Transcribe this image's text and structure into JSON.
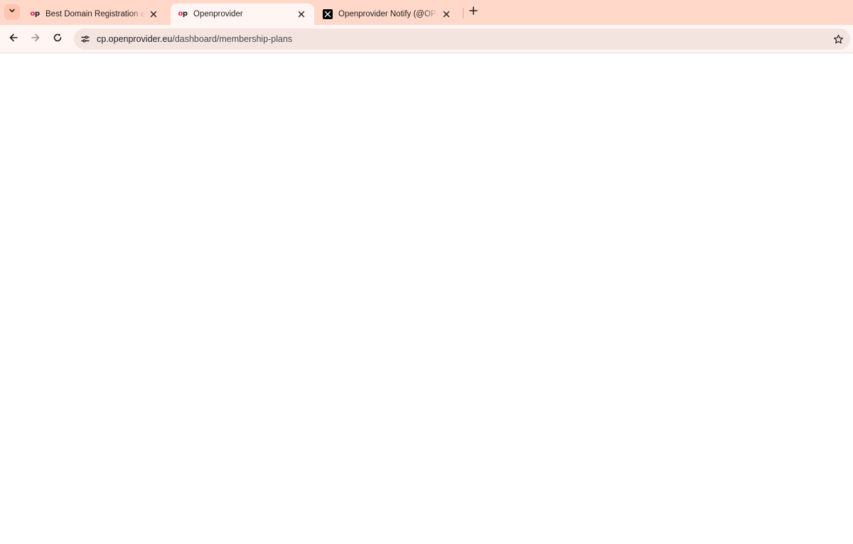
{
  "browser": {
    "tabs": [
      {
        "title": "Best Domain Registration and R",
        "favicon": "openprovider-logo",
        "active": false
      },
      {
        "title": "Openprovider",
        "favicon": "openprovider-logo",
        "active": true
      },
      {
        "title": "Openprovider Notify (@OPNoti",
        "favicon": "x-logo",
        "active": false
      }
    ],
    "favicon_text": "op",
    "address_bar": {
      "domain": "cp.openprovider.eu",
      "path": "/dashboard/membership-plans"
    },
    "icons": {
      "tab_search": "chevron-down-icon",
      "close": "close-icon",
      "new_tab": "plus-icon",
      "back": "arrow-left-icon",
      "forward": "arrow-right-icon",
      "reload": "reload-icon",
      "site_info": "tune-icon",
      "bookmark": "star-icon"
    },
    "colors": {
      "tabstrip": "#ffd8c9",
      "toolbar": "#fff5f2",
      "omnibox": "#f3e4e0",
      "brand_accent": "#e8175d"
    }
  },
  "page": {
    "state": "blank"
  }
}
